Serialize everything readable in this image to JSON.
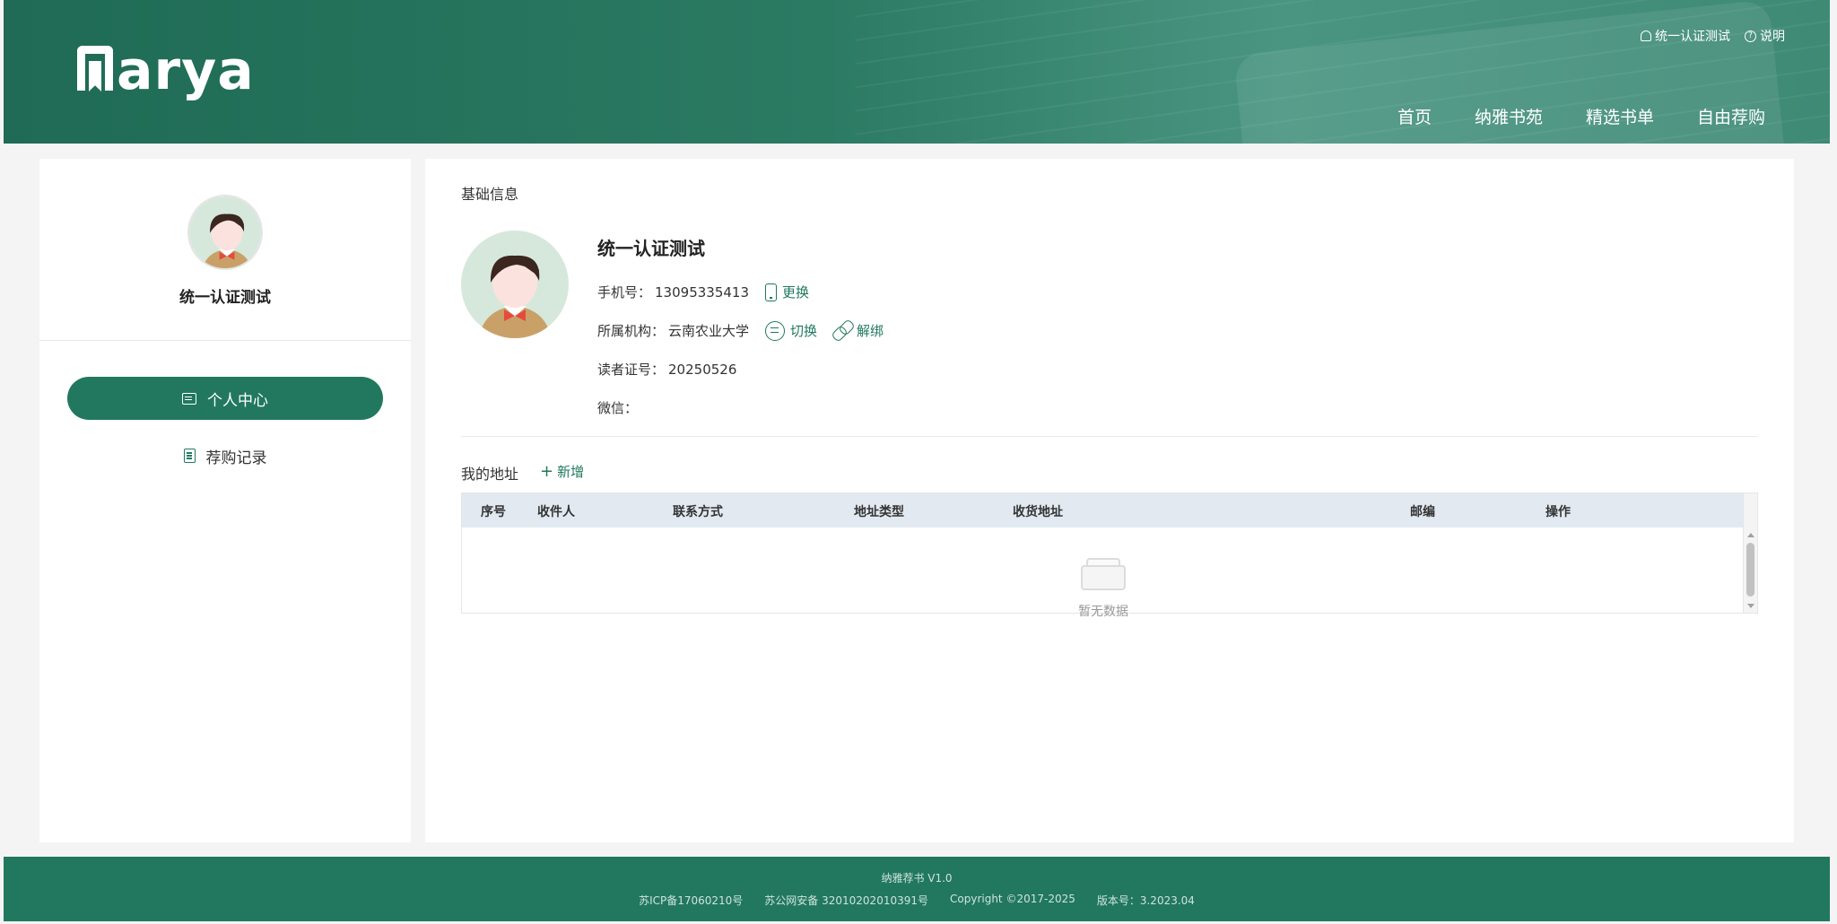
{
  "header": {
    "logo_text": "arya",
    "user_link": "统一认证测试",
    "help_link": "说明",
    "nav": [
      "首页",
      "纳雅书苑",
      "精选书单",
      "自由荐购"
    ]
  },
  "sidebar": {
    "user_name": "统一认证测试",
    "menu": [
      {
        "label": "个人中心",
        "active": true,
        "icon": "id-card-icon"
      },
      {
        "label": "荐购记录",
        "active": false,
        "icon": "document-icon"
      }
    ]
  },
  "profile": {
    "section_title": "基础信息",
    "name": "统一认证测试",
    "phone_label": "手机号：",
    "phone": "13095335413",
    "phone_action": "更换",
    "org_label": "所属机构：",
    "org": "云南农业大学",
    "switch_action": "切换",
    "unbind_action": "解绑",
    "reader_label": "读者证号：",
    "reader_id": "20250526",
    "wechat_label": "微信："
  },
  "address": {
    "title": "我的地址",
    "add_label": "新增",
    "columns": [
      "序号",
      "收件人",
      "联系方式",
      "地址类型",
      "收货地址",
      "邮编",
      "操作"
    ],
    "rows": [],
    "empty_text": "暂无数据"
  },
  "footer": {
    "line1": "纳雅荐书 V1.0",
    "icp": "苏ICP备17060210号",
    "police": "苏公网安备 32010202010391号",
    "copyright": "Copyright ©2017-2025",
    "version": "版本号：3.2023.04"
  },
  "colors": {
    "brand": "#21785f",
    "table_header": "#e2e9f1"
  }
}
